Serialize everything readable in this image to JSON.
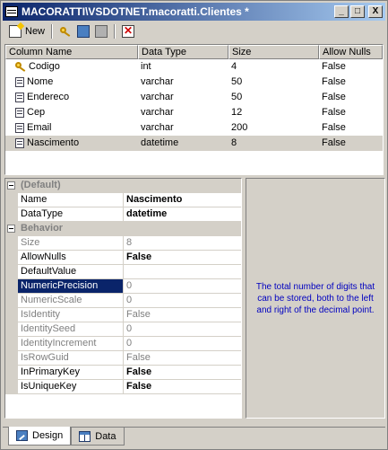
{
  "window": {
    "title": "MACORATTI\\VSDOTNET.macoratti.Clientes *",
    "min_label": "_",
    "max_label": "□",
    "close_label": "X"
  },
  "toolbar": {
    "new_label": "New"
  },
  "grid": {
    "headers": [
      "Column Name",
      "Data Type",
      "Size",
      "Allow Nulls"
    ],
    "rows": [
      {
        "icon": "primary-key-icon",
        "name": "Codigo",
        "type": "int",
        "size": "4",
        "nulls": "False"
      },
      {
        "icon": "column-icon",
        "name": "Nome",
        "type": "varchar",
        "size": "50",
        "nulls": "False"
      },
      {
        "icon": "column-icon",
        "name": "Endereco",
        "type": "varchar",
        "size": "50",
        "nulls": "False"
      },
      {
        "icon": "column-icon",
        "name": "Cep",
        "type": "varchar",
        "size": "12",
        "nulls": "False"
      },
      {
        "icon": "column-icon",
        "name": "Email",
        "type": "varchar",
        "size": "200",
        "nulls": "False"
      },
      {
        "icon": "column-icon",
        "name": "Nascimento",
        "type": "datetime",
        "size": "8",
        "nulls": "False",
        "selected": true
      }
    ]
  },
  "properties": {
    "default_category": "(Default)",
    "name_label": "Name",
    "name_value": "Nascimento",
    "datatype_label": "DataType",
    "datatype_value": "datetime",
    "behavior_category": "Behavior",
    "size_label": "Size",
    "size_value": "8",
    "allownulls_label": "AllowNulls",
    "allownulls_value": "False",
    "defaultvalue_label": "DefaultValue",
    "defaultvalue_value": "",
    "numericprecision_label": "NumericPrecision",
    "numericprecision_value": "0",
    "numericscale_label": "NumericScale",
    "numericscale_value": "0",
    "isidentity_label": "IsIdentity",
    "isidentity_value": "False",
    "identityseed_label": "IdentitySeed",
    "identityseed_value": "0",
    "identityincrement_label": "IdentityIncrement",
    "identityincrement_value": "0",
    "isrowguid_label": "IsRowGuid",
    "isrowguid_value": "False",
    "isinprimarykey_label": "InPrimaryKey",
    "isinprimarykey_value": "False",
    "isuniquekey_label": "IsUniqueKey",
    "isuniquekey_value": "False"
  },
  "description": {
    "text": "The total number of digits that can be stored, both to the left and right of the decimal point."
  },
  "tabs": {
    "design_label": "Design",
    "data_label": "Data"
  },
  "colors": {
    "title_gradient_start": "#0a246a",
    "title_gradient_end": "#a6caf0",
    "description_text": "#0000c0",
    "selection": "#0a246a"
  }
}
